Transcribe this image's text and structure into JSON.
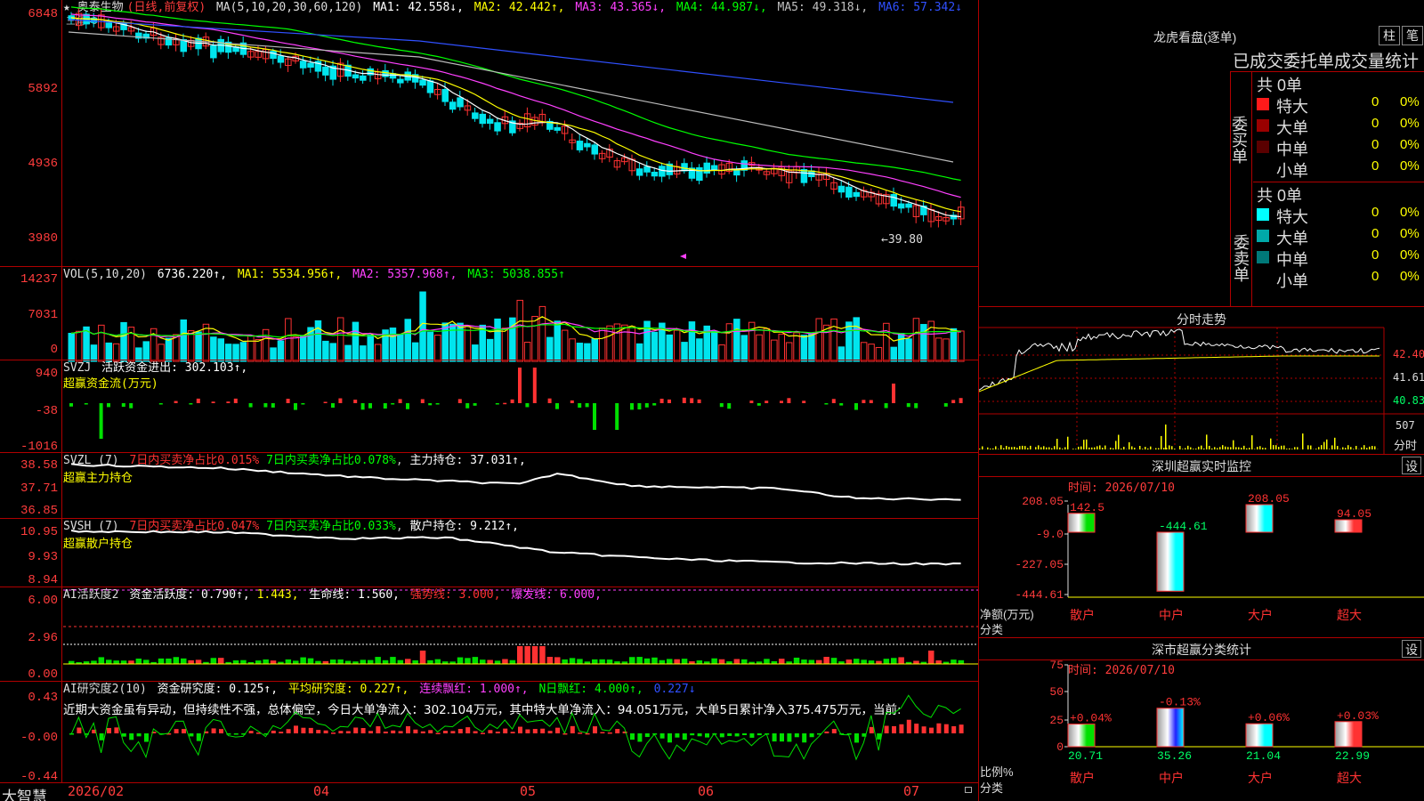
{
  "colors": {
    "up": "#ff3232",
    "down": "#00e5ee",
    "axis": "#b00000",
    "bg": "#000000"
  },
  "main": {
    "star": "★",
    "name": "奥泰生物",
    "mode": "(日线,前复权)",
    "ma_label": "MA(5,10,20,30,60,120)",
    "ma1": "MA1: 42.558↓,",
    "ma2": "MA2: 42.442↑,",
    "ma3": "MA3: 43.365↓,",
    "ma4": "MA4: 44.987↓,",
    "ma5": "MA5: 49.318↓,",
    "ma6": "MA6: 57.342↓",
    "y_labels": [
      "6848",
      "5892",
      "4936",
      "3980"
    ],
    "low_label": "←39.80",
    "overlay": "三角48"
  },
  "vol": {
    "label": "VOL(5,10,20)",
    "value": "6736.220↑,",
    "ma1": "MA1: 5534.956↑,",
    "ma2": "MA2: 5357.968↑,",
    "ma3": "MA3: 5038.855↑",
    "y_labels": [
      "14237",
      "7031",
      "0"
    ]
  },
  "svzj": {
    "label": "SVZJ",
    "title": "活跃资金进出: 302.103↑,",
    "sub": "超赢资金流(万元)",
    "y_labels": [
      "940",
      "-38",
      "-1016"
    ]
  },
  "svzl": {
    "label": "SVZL (7)",
    "a": "7日内买卖净占比0.015%",
    "b": "7日内买卖净占比0.078%",
    "c": "主力持仓: 37.031↑,",
    "sub": "超赢主力持仓",
    "y_labels": [
      "38.58",
      "37.71",
      "36.85"
    ]
  },
  "svsh": {
    "label": "SVSH (7)",
    "a": "7日内买卖净占比0.047%",
    "b": "7日内买卖净占比0.033%",
    "c": "散户持仓: 9.212↑,",
    "sub": "超赢散户持仓",
    "y_labels": [
      "10.95",
      "9.93",
      "8.94"
    ]
  },
  "ai1": {
    "label": "AI活跃度2",
    "a": "资金活跃度: 0.790↑,",
    "b": "1.443,",
    "c": "生命线: 1.560,",
    "d": "强势线: 3.000,",
    "e": "爆发线: 6.000,",
    "y_labels": [
      "6.00",
      "2.96",
      "0.00"
    ]
  },
  "ai2": {
    "label": "AI研究度2(10)",
    "a": "资金研究度: 0.125↑,",
    "b": "平均研究度: 0.227↑,",
    "c": "连续飘红: 1.000↑,",
    "d": "N日飘红: 4.000↑,",
    "e": "0.227↓",
    "text": "近期大资金虽有异动，但持续性不强，总体偏空，今日大单净流入：302.104万元，其中特大单净流入：94.051万元，大单5日累计净入375.475万元，当前:",
    "y_labels": [
      "0.43",
      "-0.00",
      "-0.44"
    ]
  },
  "xaxis": {
    "brand": "大智慧",
    "labels": [
      "2026/02",
      "04",
      "05",
      "06",
      "07"
    ]
  },
  "right": {
    "lhb": {
      "title": "龙虎看盘(逐单)",
      "tab1": "柱",
      "tab2": "笔",
      "header": "已成交委托单成交量统计",
      "buy": {
        "side": "委买单",
        "total": "共 0单",
        "rows": [
          {
            "label": "特大",
            "n": "0",
            "p": "0%",
            "c": "#ff1a1a"
          },
          {
            "label": "大单",
            "n": "0",
            "p": "0%",
            "c": "#9a0000"
          },
          {
            "label": "中单",
            "n": "0",
            "p": "0%",
            "c": "#5a0000"
          },
          {
            "label": "小单",
            "n": "0",
            "p": "0%",
            "c": ""
          }
        ]
      },
      "sell": {
        "side": "委卖单",
        "total": "共 0单",
        "rows": [
          {
            "label": "特大",
            "n": "0",
            "p": "0%",
            "c": "#00ffff"
          },
          {
            "label": "大单",
            "n": "0",
            "p": "0%",
            "c": "#00a8a8"
          },
          {
            "label": "中单",
            "n": "0",
            "p": "0%",
            "c": "#007878"
          },
          {
            "label": "小单",
            "n": "0",
            "p": "0%",
            "c": ""
          }
        ]
      }
    },
    "fs": {
      "title": "分时走势",
      "y": [
        "42.40",
        "41.61",
        "40.83"
      ],
      "vol": "507",
      "vlab": "分时"
    },
    "sz": {
      "title": "深圳超赢实时监控",
      "btn": "设",
      "time": "时间: 2026/07/10",
      "y": [
        "208.05",
        "-9.0",
        "-227.05",
        "-444.61"
      ],
      "ylabel": "净额(万元)",
      "xlabel": "分类",
      "cats": [
        "散户",
        "中户",
        "大户",
        "超大"
      ],
      "values": [
        142.5,
        -444.61,
        208.05,
        94.05
      ],
      "vlabels": [
        "142.5",
        "-444.61",
        "208.05",
        "94.05"
      ]
    },
    "ss": {
      "title": "深市超赢分类统计",
      "btn": "设",
      "time": "时间: 2026/07/10",
      "y": [
        "75",
        "50",
        "25",
        "0"
      ],
      "ylabel": "比例%",
      "xlabel": "分类",
      "cats": [
        "散户",
        "中户",
        "大户",
        "超大"
      ],
      "values": [
        20.71,
        35.26,
        21.04,
        22.99
      ],
      "pct": [
        "+0.04%",
        "-0.13%",
        "+0.06%",
        "+0.03%"
      ],
      "vlabels": [
        "20.71",
        "35.26",
        "21.04",
        "22.99"
      ]
    }
  }
}
